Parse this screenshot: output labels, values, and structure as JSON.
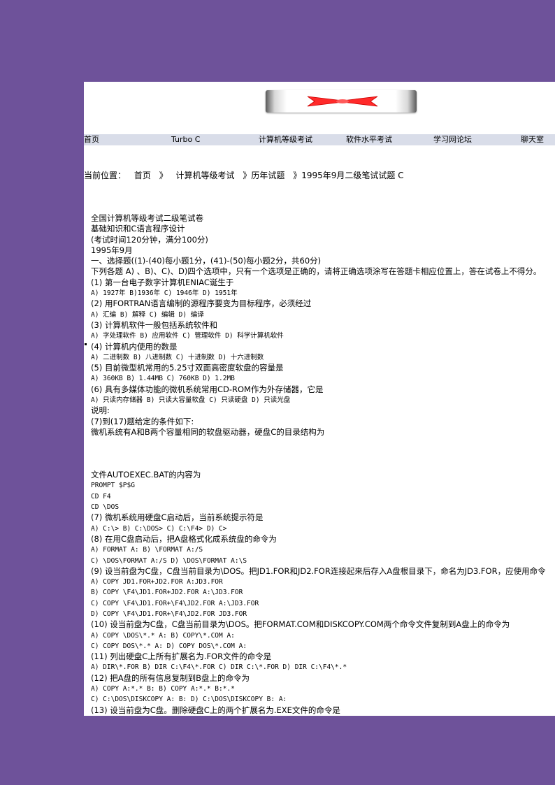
{
  "banner": {
    "icon": "red-x-logo"
  },
  "nav": [
    "首页",
    "Turbo C",
    "计算机等级考试",
    "软件水平考试",
    "学习网论坛",
    "聊天室"
  ],
  "breadcrumb": {
    "prefix": "当前位置：",
    "items": [
      "首页",
      "》",
      "计算机等级考试",
      "》历年试题",
      "》1995年9月二级笔试试题 C"
    ]
  },
  "content": [
    {
      "t": "全国计算机等级考试二级笔试卷",
      "k": "text"
    },
    {
      "t": "基础知识和C语言程序设计",
      "k": "text"
    },
    {
      "t": "(考试时间120分钟，满分100分)",
      "k": "text"
    },
    {
      "t": "1995年9月",
      "k": "text"
    },
    {
      "t": "一、选择题((1)-(40)每小题1分，(41)-(50)每小题2分，共60分)",
      "k": "text"
    },
    {
      "t": "下列各题 A) 、B)、C)、D)四个选项中，只有一个选项是正确的，请将正确选项涂写在答题卡相应位置上，答在试卷上不得分。",
      "k": "text"
    },
    {
      "t": "(1) 第一台电子数字计算机ENIAC诞生于",
      "k": "text"
    },
    {
      "t": "A) 1927年 B)1936年 C) 1946年 D) 1951年",
      "k": "opt"
    },
    {
      "t": "(2) 用FORTRAN语言编制的源程序要变为目标程序，必须经过",
      "k": "text"
    },
    {
      "t": "A) 汇编 B) 解释 C) 编辑 D) 编译",
      "k": "opt"
    },
    {
      "t": "(3) 计算机软件一般包括系统软件和",
      "k": "text"
    },
    {
      "t": "A) 字处理软件 B) 应用软件 C) 管理软件 D) 科学计算机软件",
      "k": "opt"
    },
    {
      "t": "(4) 计算机内使用的数是",
      "k": "text"
    },
    {
      "t": "A) 二进制数 B) 八进制数 C) 十进制数 D) 十六进制数",
      "k": "opt"
    },
    {
      "t": "(5) 目前微型机常用的5.25寸双面高密度软盘的容量是",
      "k": "text"
    },
    {
      "t": "A) 360KB B) 1.44MB C) 760KB D) 1.2MB",
      "k": "opt"
    },
    {
      "t": "(6) 具有多媒体功能的微机系统常用CD-ROM作为外存储器，它是",
      "k": "text"
    },
    {
      "t": "A) 只读内存储器 B) 只读大容量软盘 C) 只读硬盘 D) 只读光盘",
      "k": "opt"
    },
    {
      "t": "说明:",
      "k": "text"
    },
    {
      "t": "(7)到(17)题给定的条件如下:",
      "k": "text"
    },
    {
      "t": "微机系统有A和B两个容量相同的软盘驱动器，硬盘C的目录结构为",
      "k": "text"
    },
    {
      "t": "",
      "k": "gap"
    },
    {
      "t": "",
      "k": "gap"
    },
    {
      "t": "",
      "k": "gap"
    },
    {
      "t": "文件AUTOEXEC.BAT的内容为",
      "k": "text"
    },
    {
      "t": "PROMPT $P$G",
      "k": "opt"
    },
    {
      "t": "CD F4",
      "k": "opt"
    },
    {
      "t": "CD \\DOS",
      "k": "opt"
    },
    {
      "t": "(7) 微机系统用硬盘C启动后，当前系统提示符是",
      "k": "text"
    },
    {
      "t": "A) C:\\> B) C:\\DOS> C) C:\\F4> D) C>",
      "k": "opt"
    },
    {
      "t": "(8) 在用C盘启动后，把A盘格式化成系统盘的命令为",
      "k": "text"
    },
    {
      "t": "A) FORMAT A: B) \\FORMAT A:/S",
      "k": "opt"
    },
    {
      "t": "C) \\DOS\\FORMAT A:/S D) \\DOS\\FORMAT A:\\S",
      "k": "opt"
    },
    {
      "t": "(9) 设当前盘为C盘，C盘当前目录为\\DOS。把JD1.FOR和JD2.FOR连接起来后存入A盘根目录下，命名为JD3.FOR，应使用命令",
      "k": "text"
    },
    {
      "t": "A) COPY JD1.FOR+JD2.FOR A:JD3.FOR",
      "k": "opt"
    },
    {
      "t": "B) COPY \\F4\\JD1.FOR+JD2.FOR A:\\JD3.FOR",
      "k": "opt"
    },
    {
      "t": "C) COPY \\F4\\JD1.FOR+\\F4\\JD2.FOR A:\\JD3.FOR",
      "k": "opt"
    },
    {
      "t": "D) COPY \\F4\\JD1.FOR+\\F4\\JD2.FOR JD3.FOR",
      "k": "opt"
    },
    {
      "t": "(10) 设当前盘为C盘，C盘当前目录为\\DOS。把FORMAT.COM和DISKCOPY.COM两个命令文件复制到A盘上的命令为",
      "k": "text"
    },
    {
      "t": "A) COPY \\DOS\\*.* A: B) COPY\\*.COM A:",
      "k": "opt"
    },
    {
      "t": "C) COPY DOS\\*.* A: D) COPY DOS\\*.COM A:",
      "k": "opt"
    },
    {
      "t": "(11) 列出硬盘C上所有扩展名为.FOR文件的命令是",
      "k": "text"
    },
    {
      "t": "A) DIR\\*.FOR B) DIR C:\\F4\\*.FOR C) DIR C:\\*.FOR D) DIR C:\\F4\\*.*",
      "k": "opt"
    },
    {
      "t": "(12) 把A盘的所有信息复制到B盘上的命令为",
      "k": "text"
    },
    {
      "t": "A) COPY A:*.* B: B) COPY A:*.* B:*.*",
      "k": "opt"
    },
    {
      "t": "C) C:\\DOS\\DISKCOPY A: B: D) C:\\DOS\\DISKCOPY B: A:",
      "k": "opt"
    },
    {
      "t": "(13) 设当前盘为C盘。删除硬盘C上的两个扩展名为.EXE文件的命令是",
      "k": "text"
    }
  ]
}
